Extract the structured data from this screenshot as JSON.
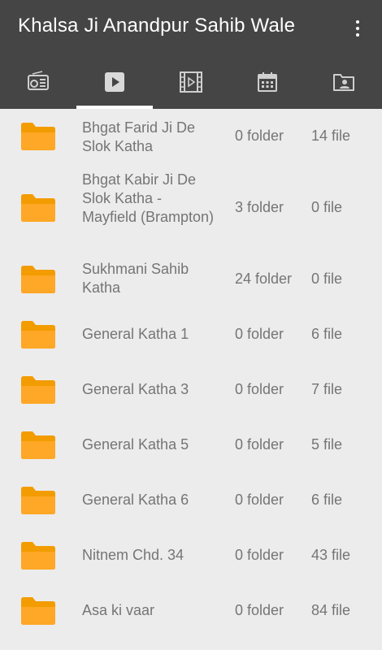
{
  "app": {
    "title": "Khalsa Ji Anandpur Sahib Wale",
    "accent_color": "#ffffff",
    "toolbar_color": "#454545",
    "folder_color": "#ffa000"
  },
  "tabs": [
    {
      "icon": "radio-icon",
      "selected": false
    },
    {
      "icon": "play-icon",
      "selected": true
    },
    {
      "icon": "video-film-icon",
      "selected": false
    },
    {
      "icon": "calendar-icon",
      "selected": false
    },
    {
      "icon": "folder-account-icon",
      "selected": false
    }
  ],
  "items": [
    {
      "name": "Bhgat Farid Ji De Slok Katha",
      "folders": "0 folder",
      "files": "14 file"
    },
    {
      "name": "Bhgat Kabir Ji De Slok Katha - Mayfield (Brampton)",
      "folders": "3 folder",
      "files": "0 file"
    },
    {
      "name": "Sukhmani Sahib Katha",
      "folders": "24 folder",
      "files": "0 file"
    },
    {
      "name": "General Katha 1",
      "folders": "0 folder",
      "files": "6 file"
    },
    {
      "name": "General Katha 3",
      "folders": "0 folder",
      "files": "7 file"
    },
    {
      "name": "General Katha 5",
      "folders": "0 folder",
      "files": "5 file"
    },
    {
      "name": "General Katha 6",
      "folders": "0 folder",
      "files": "6 file"
    },
    {
      "name": "Nitnem Chd. 34",
      "folders": "0 folder",
      "files": "43 file"
    },
    {
      "name": "Asa ki vaar",
      "folders": "0 folder",
      "files": "84 file"
    }
  ]
}
